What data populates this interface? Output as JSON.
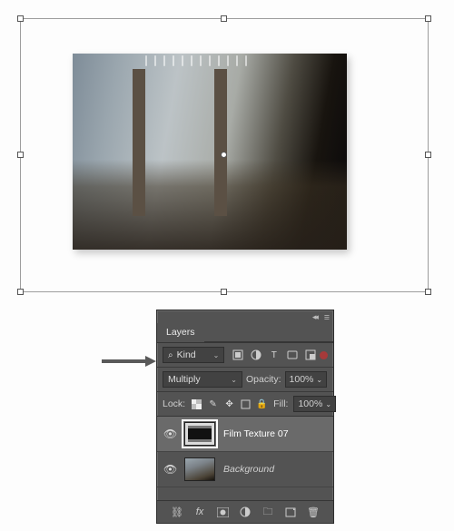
{
  "canvas": {
    "bbox_handles": [
      "tl",
      "tm",
      "tr",
      "ml",
      "c",
      "mr",
      "bl",
      "bm",
      "br"
    ]
  },
  "panel": {
    "title": "Layers",
    "filter": {
      "mode_label": "Kind",
      "icons": [
        "image",
        "fx-circle",
        "text",
        "shape",
        "smart-object"
      ]
    },
    "blend_mode": "Multiply",
    "opacity": {
      "label": "Opacity:",
      "value": "100%"
    },
    "lock": {
      "label": "Lock:",
      "icons": [
        "lock-transparency",
        "lock-image",
        "lock-position",
        "lock-artboard",
        "lock-all"
      ]
    },
    "fill": {
      "label": "Fill:",
      "value": "100%"
    },
    "layers": [
      {
        "name": "Film Texture 07",
        "visible": true,
        "selected": true,
        "thumb": "film",
        "italic": false
      },
      {
        "name": "Background",
        "visible": true,
        "selected": false,
        "thumb": "bridge",
        "italic": true
      }
    ],
    "footer_icons": [
      "link",
      "fx",
      "mask",
      "adjustment",
      "group",
      "new",
      "trash"
    ]
  }
}
